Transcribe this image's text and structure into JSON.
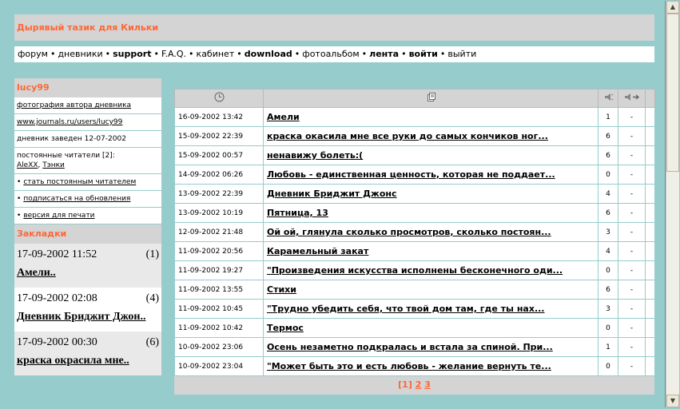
{
  "site_title": "Дырявый тазик для Кильки",
  "nav": [
    {
      "label": "форум",
      "bold": false
    },
    {
      "label": "дневники",
      "bold": false
    },
    {
      "label": "support",
      "bold": true
    },
    {
      "label": "F.A.Q.",
      "bold": false
    },
    {
      "label": "кабинет",
      "bold": false
    },
    {
      "label": "download",
      "bold": true
    },
    {
      "label": "фотоальбом",
      "bold": false
    },
    {
      "label": "лента",
      "bold": true
    },
    {
      "label": "войти",
      "bold": true
    },
    {
      "label": "выйти",
      "bold": false
    }
  ],
  "nav_separator": "•",
  "sidebar": {
    "username": "lucy99",
    "photo_link": "фотография автора дневника",
    "journal_url": "www.journals.ru/users/lucy99",
    "created": "дневник заведен 12-07-2002",
    "readers_label": "постоянные читатели [2]:",
    "readers": [
      "AleXX",
      "Тэнки"
    ],
    "actions": [
      "стать постоянным читателем",
      "подписаться на обновления",
      "версия для печати"
    ],
    "bookmarks_title": "Закладки",
    "bookmarks": [
      {
        "date": "17-09-2002 11:52",
        "count": "(1)",
        "title": "Амели.."
      },
      {
        "date": "17-09-2002 02:08",
        "count": "(4)",
        "title": "Дневник Бриджит Джон.."
      },
      {
        "date": "17-09-2002 00:30",
        "count": "(6)",
        "title": "краска окрасила мне.."
      }
    ]
  },
  "icons": {
    "date_col": "clock-icon",
    "title_col": "document-icon",
    "comments_col": "speaker-icon",
    "last_col": "speaker-arrow-icon"
  },
  "entries": [
    {
      "date": "16-09-2002 13:42",
      "title": "Амели",
      "count": "1",
      "last": "-"
    },
    {
      "date": "15-09-2002 22:39",
      "title": "краска окасила мне все руки до самых кончиков ног...",
      "count": "6",
      "last": "-"
    },
    {
      "date": "15-09-2002 00:57",
      "title": "ненавижу болеть:(",
      "count": "6",
      "last": "-"
    },
    {
      "date": "14-09-2002 06:26",
      "title": "Любовь - единственная ценность, которая не поддает...",
      "count": "0",
      "last": "-"
    },
    {
      "date": "13-09-2002 22:39",
      "title": "Дневник Бриджит Джонс",
      "count": "4",
      "last": "-"
    },
    {
      "date": "13-09-2002 10:19",
      "title": "Пятница, 13",
      "count": "6",
      "last": "-"
    },
    {
      "date": "12-09-2002 21:48",
      "title": "Ой ой, глянула сколько просмотров, сколько постоян...",
      "count": "3",
      "last": "-"
    },
    {
      "date": "11-09-2002 20:56",
      "title": "Карамельный закат",
      "count": "4",
      "last": "-"
    },
    {
      "date": "11-09-2002 19:27",
      "title": "\"Произведения искусства исполнены бесконечного оди...",
      "count": "0",
      "last": "-"
    },
    {
      "date": "11-09-2002 13:55",
      "title": "Стихи",
      "count": "6",
      "last": "-"
    },
    {
      "date": "11-09-2002 10:45",
      "title": "\"Трудно убедить себя, что твой дом там, где ты нах...",
      "count": "3",
      "last": "-"
    },
    {
      "date": "11-09-2002 10:42",
      "title": "Термос",
      "count": "0",
      "last": "-"
    },
    {
      "date": "10-09-2002 23:06",
      "title": "Осень незаметно подкралась и встала за спиной. При...",
      "count": "1",
      "last": "-"
    },
    {
      "date": "10-09-2002 23:04",
      "title": "\"Может быть это и есть любовь - желание вернуть те...",
      "count": "0",
      "last": "-"
    }
  ],
  "pager": {
    "current": "[1]",
    "pages": [
      "2",
      "3"
    ]
  },
  "colors": {
    "accent": "#ff6633",
    "background": "#96cccc",
    "panel": "#d4d4d4"
  }
}
